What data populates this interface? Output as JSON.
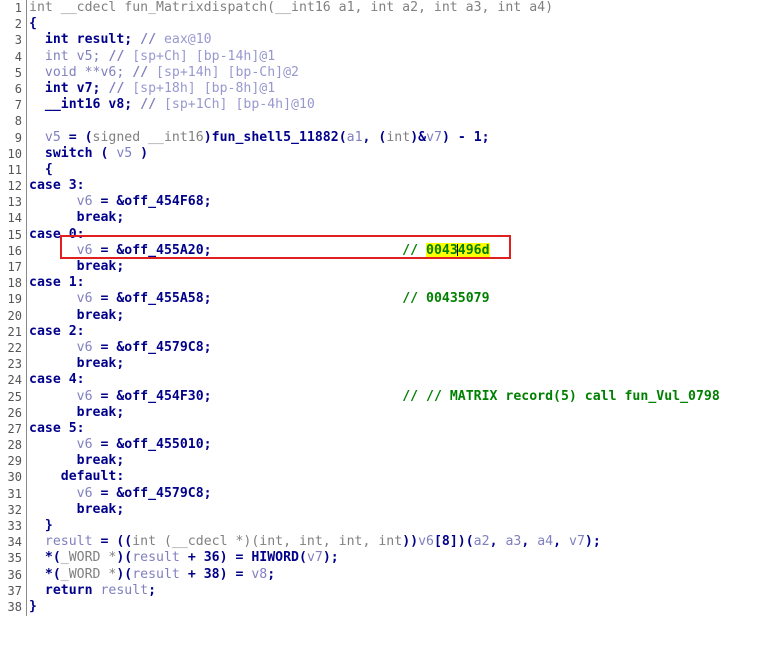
{
  "view": {
    "name": "decompiler-pseudocode",
    "background": "#ffffff",
    "gutter_color": "#555555",
    "accent_red": "#e02020",
    "highlight_yellow": "#ffff00",
    "comment_green": "#008000",
    "keyword_blue": "#00008b",
    "local_var_lavender": "#8080c0",
    "type_gray": "#808080"
  },
  "annotation": {
    "name": "focus-rectangle",
    "color": "#e02020",
    "target_line": 16
  },
  "selection": {
    "text": "0043496d",
    "before_caret": "0043",
    "after_caret": "496d",
    "background": "#ffff00",
    "line": 16
  },
  "lines": [
    {
      "n": "1",
      "text": "int __cdecl fun_Matrixdispatch(__int16 a1, int a2, int a3, int a4)"
    },
    {
      "n": "2",
      "text": "{"
    },
    {
      "n": "3",
      "text": "  int result; // eax@10"
    },
    {
      "n": "4",
      "text": "  int v5; // [sp+Ch] [bp-14h]@1"
    },
    {
      "n": "5",
      "text": "  void **v6; // [sp+14h] [bp-Ch]@2"
    },
    {
      "n": "6",
      "text": "  int v7; // [sp+18h] [bp-8h]@1"
    },
    {
      "n": "7",
      "text": "  __int16 v8; // [sp+1Ch] [bp-4h]@10"
    },
    {
      "n": "8",
      "text": ""
    },
    {
      "n": "9",
      "text": "  v5 = (signed __int16)fun_shell5_11882(a1, (int)&v7) - 1;"
    },
    {
      "n": "10",
      "text": "  switch ( v5 )"
    },
    {
      "n": "11",
      "text": "  {"
    },
    {
      "n": "12",
      "text": "    case 3:"
    },
    {
      "n": "13",
      "text": "      v6 = &off_454F68;"
    },
    {
      "n": "14",
      "text": "      break;"
    },
    {
      "n": "15",
      "text": "    case 0:"
    },
    {
      "n": "16",
      "text": "      v6 = &off_455A20;                        // 0043496d"
    },
    {
      "n": "17",
      "text": "      break;"
    },
    {
      "n": "18",
      "text": "    case 1:"
    },
    {
      "n": "19",
      "text": "      v6 = &off_455A58;                        // 00435079"
    },
    {
      "n": "20",
      "text": "      break;"
    },
    {
      "n": "21",
      "text": "    case 2:"
    },
    {
      "n": "22",
      "text": "      v6 = &off_4579C8;"
    },
    {
      "n": "23",
      "text": "      break;"
    },
    {
      "n": "24",
      "text": "    case 4:"
    },
    {
      "n": "25",
      "text": "      v6 = &off_454F30;                        // // MATRIX record(5) call fun_Vul_0798"
    },
    {
      "n": "26",
      "text": "      break;"
    },
    {
      "n": "27",
      "text": "    case 5:"
    },
    {
      "n": "28",
      "text": "      v6 = &off_455010;"
    },
    {
      "n": "29",
      "text": "      break;"
    },
    {
      "n": "30",
      "text": "    default:"
    },
    {
      "n": "31",
      "text": "      v6 = &off_4579C8;"
    },
    {
      "n": "32",
      "text": "      break;"
    },
    {
      "n": "33",
      "text": "  }"
    },
    {
      "n": "34",
      "text": "  result = ((int (__cdecl *)(int, int, int, int))v6[8])(a2, a3, a4, v7);"
    },
    {
      "n": "35",
      "text": "  *(_WORD *)(result + 36) = HIWORD(v7);"
    },
    {
      "n": "36",
      "text": "  *(_WORD *)(result + 38) = v8;"
    },
    {
      "n": "37",
      "text": "  return result;"
    },
    {
      "n": "38",
      "text": "}"
    }
  ],
  "comments": {
    "line16": "// 0043496d",
    "line19": "// 00435079",
    "line25": "// // MATRIX record(5) call fun_Vul_0798"
  },
  "function": {
    "signature": "int __cdecl fun_Matrixdispatch(__int16 a1, int a2, int a3, int a4)",
    "name": "fun_Matrixdispatch",
    "called_function": "fun_shell5_11882",
    "return_statement": "return result;"
  },
  "locals": [
    {
      "decl": "int result;",
      "comment": "// eax@10"
    },
    {
      "decl": "int v5;",
      "comment": "// [sp+Ch] [bp-14h]@1"
    },
    {
      "decl": "void **v6;",
      "comment": "// [sp+14h] [bp-Ch]@2"
    },
    {
      "decl": "int v7;",
      "comment": "// [sp+18h] [bp-8h]@1"
    },
    {
      "decl": "__int16 v8;",
      "comment": "// [sp+1Ch] [bp-4h]@10"
    }
  ],
  "switch_cases": [
    {
      "label": "case 3:",
      "assign": "v6 = &off_454F68;",
      "comment": ""
    },
    {
      "label": "case 0:",
      "assign": "v6 = &off_455A20;",
      "comment": "// 0043496d"
    },
    {
      "label": "case 1:",
      "assign": "v6 = &off_455A58;",
      "comment": "// 00435079"
    },
    {
      "label": "case 2:",
      "assign": "v6 = &off_4579C8;",
      "comment": ""
    },
    {
      "label": "case 4:",
      "assign": "v6 = &off_454F30;",
      "comment": "// // MATRIX record(5) call fun_Vul_0798"
    },
    {
      "label": "case 5:",
      "assign": "v6 = &off_455010;",
      "comment": ""
    },
    {
      "label": "default:",
      "assign": "v6 = &off_4579C8;",
      "comment": ""
    }
  ]
}
